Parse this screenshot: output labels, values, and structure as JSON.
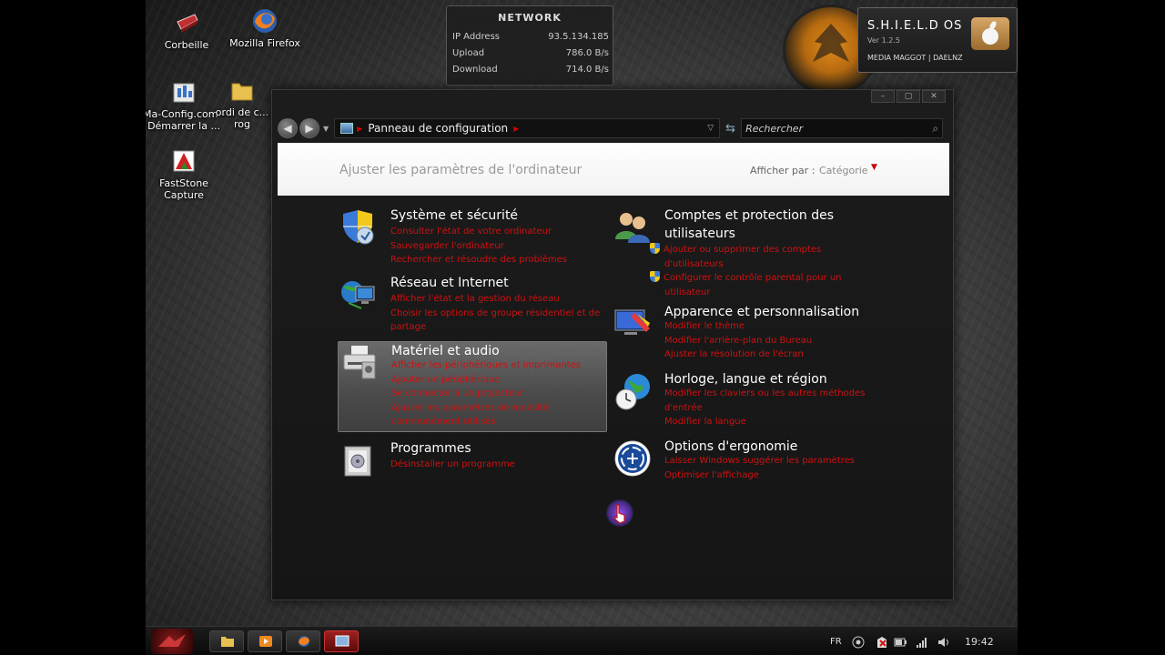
{
  "desktop_icons": [
    {
      "label": "Corbeille",
      "icon": "recycle-bin-icon"
    },
    {
      "label": "Mozilla Firefox",
      "icon": "firefox-icon"
    },
    {
      "label": "Ma-Config.com - Démarrer la ...",
      "icon": "shortcut-icon"
    },
    {
      "label": "ordi de c... rog",
      "icon": "folder-icon"
    },
    {
      "label": "FastStone Capture",
      "icon": "faststone-icon"
    }
  ],
  "network_widget": {
    "title": "NETWORK",
    "rows": [
      {
        "label": "IP Address",
        "value": "93.5.134.185"
      },
      {
        "label": "Upload",
        "value": "786.0 B/s"
      },
      {
        "label": "Download",
        "value": "714.0 B/s"
      }
    ]
  },
  "shield_widget": {
    "title": "S.H.I.E.L.D OS",
    "version": "Ver 1.2.5",
    "credits": "MEDIA MAGGOT | DAELNZ"
  },
  "window": {
    "controls": [
      "–",
      "▢",
      "✕"
    ],
    "address": "Panneau de configuration",
    "search_placeholder": "Rechercher",
    "heading": "Ajuster les paramètres de l'ordinateur",
    "view_by_label": "Afficher par :",
    "view_by_value": "Catégorie"
  },
  "categories_left": [
    {
      "title": "Système et sécurité",
      "icon": "shield-icon",
      "links": [
        "Consulter l'état de votre ordinateur",
        "Sauvegarder l'ordinateur",
        "Rechercher et résoudre des problèmes"
      ]
    },
    {
      "title": "Réseau et Internet",
      "icon": "network-icon",
      "links": [
        "Afficher l'état et la gestion du réseau",
        "Choisir les options de groupe résidentiel et de partage"
      ]
    },
    {
      "title": "Matériel et audio",
      "icon": "printer-icon",
      "links": [
        "Afficher les périphériques et imprimantes",
        "Ajouter un périphérique",
        "Se connecter à un projecteur",
        "Ajuster les paramètres de mobilité",
        "communément utilisés"
      ]
    },
    {
      "title": "Programmes",
      "icon": "programs-icon",
      "links": [
        "Désinstaller un programme"
      ]
    }
  ],
  "categories_right": [
    {
      "title": "Comptes et protection des utilisateurs",
      "icon": "users-icon",
      "links": [
        "Ajouter ou supprimer des comptes d'utilisateurs",
        "Configurer le contrôle parental pour un utilisateur"
      ]
    },
    {
      "title": "Apparence et personnalisation",
      "icon": "appearance-icon",
      "links": [
        "Modifier le thème",
        "Modifier l'arrière-plan du Bureau",
        "Ajuster la résolution de l'écran"
      ]
    },
    {
      "title": "Horloge, langue et région",
      "icon": "clock-globe-icon",
      "links": [
        "Modifier les claviers ou les autres méthodes d'entrée",
        "Modifier la langue"
      ]
    },
    {
      "title": "Options d'ergonomie",
      "icon": "ease-of-access-icon",
      "links": [
        "Laisser Windows suggérer les paramètres",
        "Optimiser l'affichage"
      ]
    }
  ],
  "taskbar": {
    "language": "FR",
    "time": "19:42"
  },
  "colors": {
    "link": "#d01010",
    "accent": "#c00000",
    "header_bg": "#ffffff"
  }
}
